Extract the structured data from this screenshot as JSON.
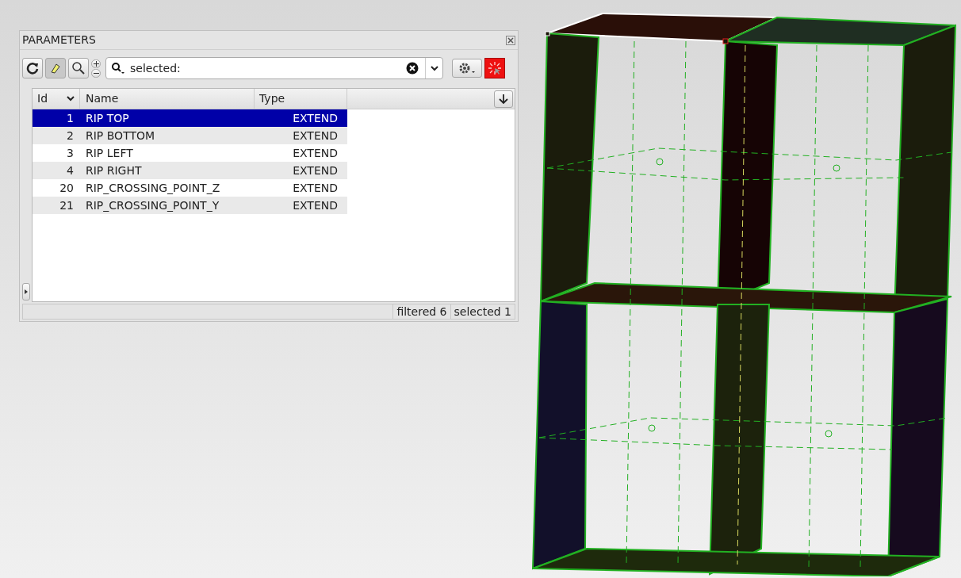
{
  "panel": {
    "title": "PARAMETERS",
    "search": {
      "value": "selected:"
    },
    "table": {
      "columns": [
        "Id",
        "Name",
        "Type"
      ],
      "rows": [
        {
          "id": "1",
          "name": "RIP TOP",
          "type": "EXTEND",
          "selected": true
        },
        {
          "id": "2",
          "name": "RIP BOTTOM",
          "type": "EXTEND",
          "selected": false
        },
        {
          "id": "3",
          "name": "RIP LEFT",
          "type": "EXTEND",
          "selected": false
        },
        {
          "id": "4",
          "name": "RIP RIGHT",
          "type": "EXTEND",
          "selected": false
        },
        {
          "id": "20",
          "name": "RIP_CROSSING_POINT_Z",
          "type": "EXTEND",
          "selected": false
        },
        {
          "id": "21",
          "name": "RIP_CROSSING_POINT_Y",
          "type": "EXTEND",
          "selected": false
        }
      ]
    },
    "status_bar": [
      "filtered 6",
      "selected 1"
    ]
  }
}
